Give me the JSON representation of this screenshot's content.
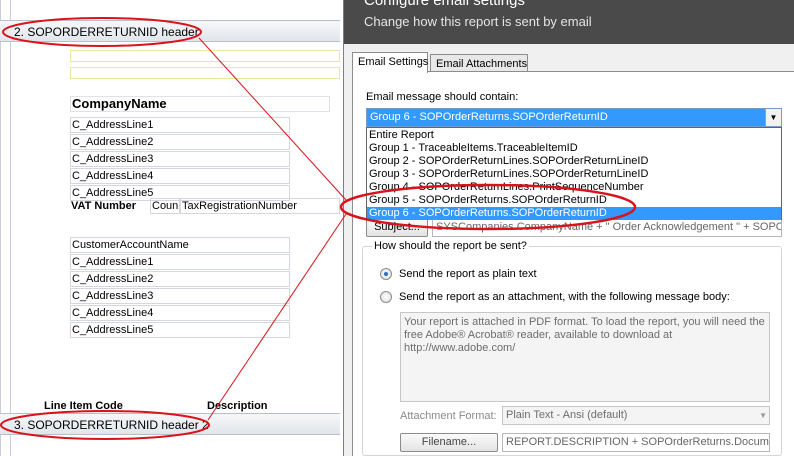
{
  "designer": {
    "header_band_2": "2. SOPORDERRETURNID header",
    "header_band_3": "3. SOPORDERRETURNID header 2",
    "company_name": "CompanyName",
    "company_address": [
      "C_AddressLine1",
      "C_AddressLine2",
      "C_AddressLine3",
      "C_AddressLine4",
      "C_AddressLine5"
    ],
    "vat_label": "VAT Number",
    "vat_country_field": "Coun",
    "vat_reg_field": "TaxRegistrationNumber",
    "customer_account": "CustomerAccountName",
    "customer_address": [
      "C_AddressLine1",
      "C_AddressLine2",
      "C_AddressLine3",
      "C_AddressLine4",
      "C_AddressLine5"
    ],
    "col_line_item_code": "Line Item Code",
    "col_description": "Description"
  },
  "dialog": {
    "title": "Configure email settings",
    "subtitle": "Change how this report is sent by email",
    "tabs": [
      "Email Settings",
      "Email Attachments"
    ],
    "contain_label": "Email message should contain:",
    "selected_option": "Group 6 - SOPOrderReturns.SOPOrderReturnID",
    "options": [
      "Entire Report",
      "Group 1 - TraceableItems.TraceableItemID",
      "Group 2 - SOPOrderReturnLines.SOPOrderReturnLineID",
      "Group 3 - SOPOrderReturnLines.SOPOrderReturnLineID",
      "Group 4 - SOPOrderReturnLines.PrintSequenceNumber",
      "Group 5 - SOPOrderReturns.SOPOrderReturnID",
      "Group 6 - SOPOrderReturns.SOPOrderReturnID"
    ],
    "subject_button": "Subject...",
    "subject_value": "SYSCompanies.CompanyName + \" Order Acknowledgement \" + SOPOrd",
    "send_group_title": "How should the report be sent?",
    "radio_plain": "Send the report as plain text",
    "radio_attachment": "Send the report as an attachment, with the following message body:",
    "message_body": "Your report is attached in PDF format. To load the report, you will need the free Adobe® Acrobat® reader, available to download at http://www.adobe.com/",
    "attachment_format_label": "Attachment Format:",
    "attachment_format_value": "Plain Text - Ansi (default)",
    "filename_button": "Filename...",
    "filename_value": "REPORT.DESCRIPTION + SOPOrderReturns.Documen"
  }
}
